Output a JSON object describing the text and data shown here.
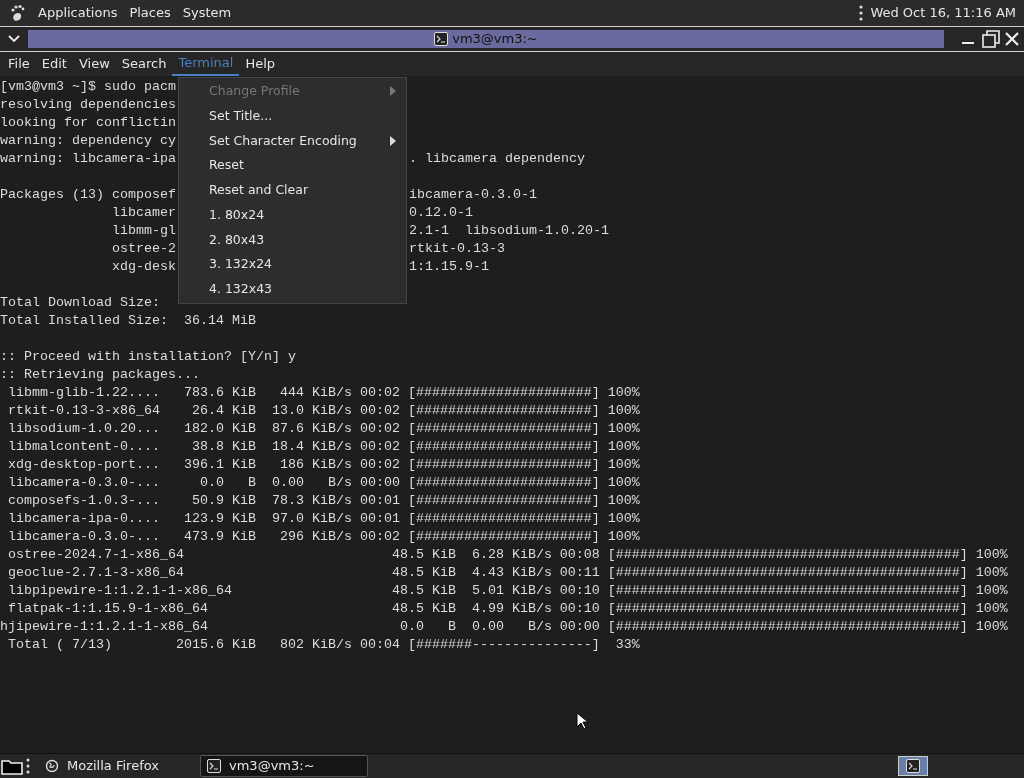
{
  "top_panel": {
    "menus": [
      "Applications",
      "Places",
      "System"
    ],
    "clock": "Wed Oct 16, 11:16 AM"
  },
  "window": {
    "title": "vm3@vm3:~"
  },
  "menubar": [
    {
      "label": "File",
      "selected": false
    },
    {
      "label": "Edit",
      "selected": false
    },
    {
      "label": "View",
      "selected": false
    },
    {
      "label": "Search",
      "selected": false
    },
    {
      "label": "Terminal",
      "selected": true
    },
    {
      "label": "Help",
      "selected": false
    }
  ],
  "terminal_lines": [
    {
      "kind": "text",
      "text": "[vm3@vm3 ~]$ sudo pacm"
    },
    {
      "kind": "text",
      "text": "resolving dependencies"
    },
    {
      "kind": "text",
      "text": "looking for conflictin"
    },
    {
      "kind": "text",
      "text": "warning: dependency cy"
    },
    {
      "kind": "text",
      "text": "warning: libcamera-ipa",
      "right": ". libcamera dependency"
    },
    {
      "kind": "blank"
    },
    {
      "kind": "text",
      "text": "Packages (13) composef",
      "right": "ibcamera-0.3.0-1"
    },
    {
      "kind": "text",
      "text": "              libcamer",
      "right": "0.12.0-1"
    },
    {
      "kind": "text",
      "text": "              libmm-gl",
      "right": "2.1-1  libsodium-1.0.20-1"
    },
    {
      "kind": "text",
      "text": "              ostree-2",
      "right": "rtkit-0.13-3"
    },
    {
      "kind": "text",
      "text": "              xdg-desk",
      "right": "1:1.15.9-1"
    },
    {
      "kind": "blank"
    },
    {
      "kind": "text",
      "text": "Total Download Size:"
    },
    {
      "kind": "text",
      "text": "Total Installed Size:  36.14 MiB"
    },
    {
      "kind": "blank"
    },
    {
      "kind": "text",
      "text": ":: Proceed with installation? [Y/n] y"
    },
    {
      "kind": "text",
      "text": ":: Retrieving packages..."
    },
    {
      "kind": "text",
      "text": " libmm-glib-1.22....   783.6 KiB   444 KiB/s 00:02 [######################] 100%"
    },
    {
      "kind": "text",
      "text": " rtkit-0.13-3-x86_64    26.4 KiB  13.0 KiB/s 00:02 [######################] 100%"
    },
    {
      "kind": "text",
      "text": " libsodium-1.0.20...   182.0 KiB  87.6 KiB/s 00:02 [######################] 100%"
    },
    {
      "kind": "text",
      "text": " libmalcontent-0....    38.8 KiB  18.4 KiB/s 00:02 [######################] 100%"
    },
    {
      "kind": "text",
      "text": " xdg-desktop-port...   396.1 KiB   186 KiB/s 00:02 [######################] 100%"
    },
    {
      "kind": "text",
      "text": " libcamera-0.3.0-...     0.0   B  0.00   B/s 00:00 [######################] 100%"
    },
    {
      "kind": "text",
      "text": " composefs-1.0.3-...    50.9 KiB  78.3 KiB/s 00:01 [######################] 100%"
    },
    {
      "kind": "text",
      "text": " libcamera-ipa-0....   123.9 KiB  97.0 KiB/s 00:01 [######################] 100%"
    },
    {
      "kind": "text",
      "text": " libcamera-0.3.0-...   473.9 KiB   296 KiB/s 00:02 [######################] 100%"
    },
    {
      "kind": "text",
      "text": " ostree-2024.7-1-x86_64                          48.5 KiB  6.28 KiB/s 00:08 [###########################################] 100%"
    },
    {
      "kind": "text",
      "text": " geoclue-2.7.1-3-x86_64                          48.5 KiB  4.43 KiB/s 00:11 [###########################################] 100%"
    },
    {
      "kind": "text",
      "text": " libpipewire-1:1.2.1-1-x86_64                    48.5 KiB  5.01 KiB/s 00:10 [###########################################] 100%"
    },
    {
      "kind": "text",
      "text": " flatpak-1:1.15.9-1-x86_64                       48.5 KiB  4.99 KiB/s 00:10 [###########################################] 100%"
    },
    {
      "kind": "text",
      "text": "hjipewire-1:1.2.1-1-x86_64                        0.0   B  0.00   B/s 00:00 [###########################################] 100%"
    },
    {
      "kind": "text",
      "text": " Total ( 7/13)        2015.6 KiB   802 KiB/s 00:04 [#######---------------]  33%"
    }
  ],
  "terminal_menu": [
    {
      "label": "Change Profile",
      "disabled": true,
      "submenu": true
    },
    {
      "label": "Set Title...",
      "disabled": false,
      "submenu": false
    },
    {
      "label": "Set Character Encoding",
      "disabled": false,
      "submenu": true
    },
    {
      "label": "Reset",
      "disabled": false,
      "submenu": false
    },
    {
      "label": "Reset and Clear",
      "disabled": false,
      "submenu": false
    },
    {
      "label": "1. 80x24",
      "disabled": false,
      "submenu": false
    },
    {
      "label": "2. 80x43",
      "disabled": false,
      "submenu": false
    },
    {
      "label": "3. 132x24",
      "disabled": false,
      "submenu": false
    },
    {
      "label": "4. 132x43",
      "disabled": false,
      "submenu": false
    }
  ],
  "taskbar": {
    "items": [
      {
        "label": "Mozilla Firefox",
        "selected": false,
        "kind": "firefox"
      },
      {
        "label": "vm3@vm3:~",
        "selected": true,
        "kind": "terminal"
      }
    ]
  }
}
